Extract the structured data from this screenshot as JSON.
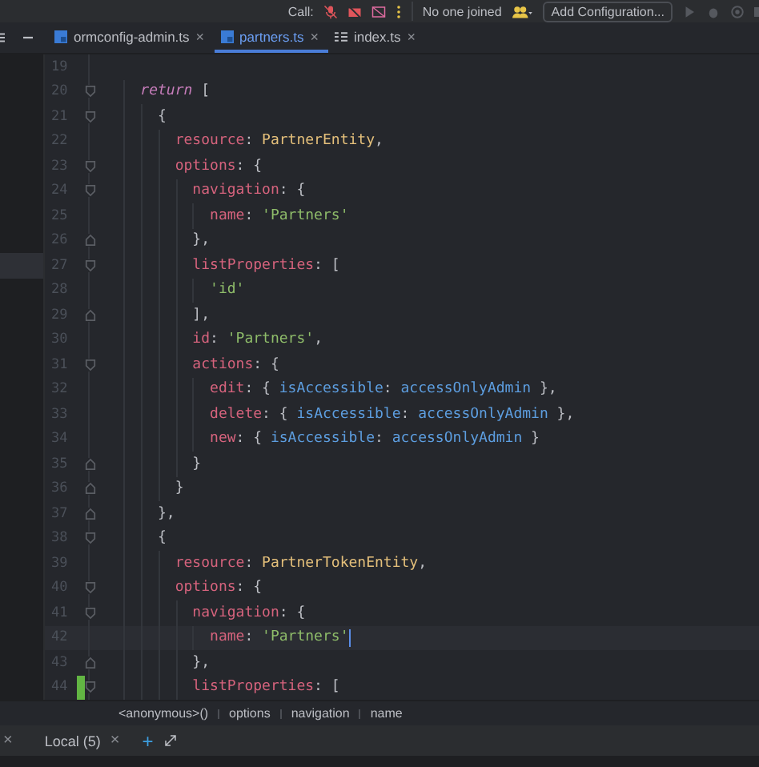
{
  "toolbar": {
    "call_label": "Call:",
    "call_status": "No one joined",
    "run_config": "Add Configuration..."
  },
  "tabs": [
    {
      "label": "ormconfig-admin.ts",
      "kind": "ts",
      "selected": false,
      "close": "×"
    },
    {
      "label": "partners.ts",
      "kind": "ts",
      "selected": true,
      "close": "×"
    },
    {
      "label": "index.ts",
      "kind": "list",
      "selected": false,
      "close": "×"
    }
  ],
  "editor": {
    "lines": [
      {
        "number": "19",
        "fold_start": false,
        "fold_end": false,
        "current": false,
        "changed": false
      },
      {
        "number": "20",
        "fold_start": true,
        "fold_end": false,
        "current": false,
        "changed": false,
        "tokens": [
          {
            "kind": "kw",
            "text": "    return"
          },
          {
            "kind": "punct",
            "text": " ["
          }
        ]
      },
      {
        "number": "21",
        "fold_start": true,
        "fold_end": false,
        "current": false,
        "changed": false,
        "tokens": [
          {
            "kind": "punct",
            "text": "      {"
          }
        ]
      },
      {
        "number": "22",
        "fold_start": false,
        "fold_end": false,
        "current": false,
        "changed": false,
        "tokens": [
          {
            "kind": "prop",
            "text": "        resource"
          },
          {
            "kind": "punct",
            "text": ": "
          },
          {
            "kind": "type",
            "text": "PartnerEntity"
          },
          {
            "kind": "punct",
            "text": ","
          }
        ]
      },
      {
        "number": "23",
        "fold_start": true,
        "fold_end": false,
        "current": false,
        "changed": false,
        "tokens": [
          {
            "kind": "prop",
            "text": "        options"
          },
          {
            "kind": "punct",
            "text": ": {"
          }
        ]
      },
      {
        "number": "24",
        "fold_start": true,
        "fold_end": false,
        "current": false,
        "changed": false,
        "tokens": [
          {
            "kind": "prop",
            "text": "          navigation"
          },
          {
            "kind": "punct",
            "text": ": {"
          }
        ]
      },
      {
        "number": "25",
        "fold_start": false,
        "fold_end": false,
        "current": false,
        "changed": false,
        "tokens": [
          {
            "kind": "prop",
            "text": "            name"
          },
          {
            "kind": "punct",
            "text": ": "
          },
          {
            "kind": "str",
            "text": "'Partners'"
          }
        ]
      },
      {
        "number": "26",
        "fold_start": false,
        "fold_end": true,
        "current": false,
        "changed": false,
        "tokens": [
          {
            "kind": "punct",
            "text": "          },"
          }
        ]
      },
      {
        "number": "27",
        "fold_start": true,
        "fold_end": false,
        "current": false,
        "changed": false,
        "tokens": [
          {
            "kind": "prop",
            "text": "          listProperties"
          },
          {
            "kind": "punct",
            "text": ": ["
          }
        ]
      },
      {
        "number": "28",
        "fold_start": false,
        "fold_end": false,
        "current": false,
        "changed": false,
        "tokens": [
          {
            "kind": "str",
            "text": "            'id'"
          }
        ]
      },
      {
        "number": "29",
        "fold_start": false,
        "fold_end": true,
        "current": false,
        "changed": false,
        "tokens": [
          {
            "kind": "punct",
            "text": "          ],"
          }
        ]
      },
      {
        "number": "30",
        "fold_start": false,
        "fold_end": false,
        "current": false,
        "changed": false,
        "tokens": [
          {
            "kind": "prop",
            "text": "          id"
          },
          {
            "kind": "punct",
            "text": ": "
          },
          {
            "kind": "str",
            "text": "'Partners'"
          },
          {
            "kind": "punct",
            "text": ","
          }
        ]
      },
      {
        "number": "31",
        "fold_start": true,
        "fold_end": false,
        "current": false,
        "changed": false,
        "tokens": [
          {
            "kind": "prop",
            "text": "          actions"
          },
          {
            "kind": "punct",
            "text": ": {"
          }
        ]
      },
      {
        "number": "32",
        "fold_start": false,
        "fold_end": false,
        "current": false,
        "changed": false,
        "tokens": [
          {
            "kind": "prop",
            "text": "            edit"
          },
          {
            "kind": "punct",
            "text": ": { "
          },
          {
            "kind": "ident",
            "text": "isAccessible"
          },
          {
            "kind": "punct",
            "text": ": "
          },
          {
            "kind": "ident",
            "text": "accessOnlyAdmin"
          },
          {
            "kind": "punct",
            "text": " },"
          }
        ]
      },
      {
        "number": "33",
        "fold_start": false,
        "fold_end": false,
        "current": false,
        "changed": false,
        "tokens": [
          {
            "kind": "prop",
            "text": "            delete"
          },
          {
            "kind": "punct",
            "text": ": { "
          },
          {
            "kind": "ident",
            "text": "isAccessible"
          },
          {
            "kind": "punct",
            "text": ": "
          },
          {
            "kind": "ident",
            "text": "accessOnlyAdmin"
          },
          {
            "kind": "punct",
            "text": " },"
          }
        ]
      },
      {
        "number": "34",
        "fold_start": false,
        "fold_end": false,
        "current": false,
        "changed": false,
        "tokens": [
          {
            "kind": "prop",
            "text": "            new"
          },
          {
            "kind": "punct",
            "text": ": { "
          },
          {
            "kind": "ident",
            "text": "isAccessible"
          },
          {
            "kind": "punct",
            "text": ": "
          },
          {
            "kind": "ident",
            "text": "accessOnlyAdmin"
          },
          {
            "kind": "punct",
            "text": " }"
          }
        ]
      },
      {
        "number": "35",
        "fold_start": false,
        "fold_end": true,
        "current": false,
        "changed": false,
        "tokens": [
          {
            "kind": "punct",
            "text": "          }"
          }
        ]
      },
      {
        "number": "36",
        "fold_start": false,
        "fold_end": true,
        "current": false,
        "changed": false,
        "tokens": [
          {
            "kind": "punct",
            "text": "        }"
          }
        ]
      },
      {
        "number": "37",
        "fold_start": false,
        "fold_end": true,
        "current": false,
        "changed": false,
        "tokens": [
          {
            "kind": "punct",
            "text": "      },"
          }
        ]
      },
      {
        "number": "38",
        "fold_start": true,
        "fold_end": false,
        "current": false,
        "changed": false,
        "tokens": [
          {
            "kind": "punct",
            "text": "      {"
          }
        ]
      },
      {
        "number": "39",
        "fold_start": false,
        "fold_end": false,
        "current": false,
        "changed": false,
        "tokens": [
          {
            "kind": "prop",
            "text": "        resource"
          },
          {
            "kind": "punct",
            "text": ": "
          },
          {
            "kind": "type",
            "text": "PartnerTokenEntity"
          },
          {
            "kind": "punct",
            "text": ","
          }
        ]
      },
      {
        "number": "40",
        "fold_start": true,
        "fold_end": false,
        "current": false,
        "changed": false,
        "tokens": [
          {
            "kind": "prop",
            "text": "        options"
          },
          {
            "kind": "punct",
            "text": ": {"
          }
        ]
      },
      {
        "number": "41",
        "fold_start": true,
        "fold_end": false,
        "current": false,
        "changed": false,
        "tokens": [
          {
            "kind": "prop",
            "text": "          navigation"
          },
          {
            "kind": "punct",
            "text": ": {"
          }
        ]
      },
      {
        "number": "42",
        "fold_start": false,
        "fold_end": false,
        "current": true,
        "changed": false,
        "tokens": [
          {
            "kind": "prop",
            "text": "            name"
          },
          {
            "kind": "punct",
            "text": ": "
          },
          {
            "kind": "str",
            "text": "'Partners'"
          }
        ]
      },
      {
        "number": "43",
        "fold_start": false,
        "fold_end": true,
        "current": false,
        "changed": false,
        "tokens": [
          {
            "kind": "punct",
            "text": "          },"
          }
        ]
      },
      {
        "number": "44",
        "fold_start": true,
        "fold_end": false,
        "current": false,
        "changed": true,
        "tokens": [
          {
            "kind": "prop",
            "text": "          listProperties"
          },
          {
            "kind": "punct",
            "text": ": ["
          }
        ]
      }
    ]
  },
  "breadcrumbs": [
    "<anonymous>()",
    "options",
    "navigation",
    "name"
  ],
  "terminal": {
    "close": "×",
    "tabs": [
      {
        "label": "Local (5)",
        "close": "×"
      }
    ],
    "add": "+"
  }
}
